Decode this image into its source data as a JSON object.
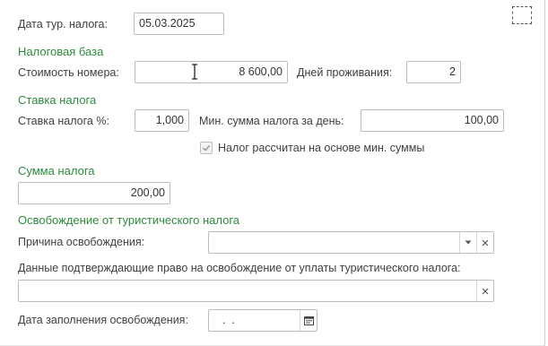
{
  "header": {
    "tour_date_label": "Дата тур. налога:",
    "tour_date_value": "05.03.2025"
  },
  "tax_base": {
    "section_title": "Налоговая база",
    "room_cost_label": "Стоимость номера:",
    "room_cost_value": "8 600,00",
    "days_label": "Дней проживания:",
    "days_value": "2"
  },
  "tax_rate": {
    "section_title": "Ставка налога",
    "rate_label": "Ставка налога %:",
    "rate_value": "1,000",
    "min_per_day_label": "Мин. сумма налога за день:",
    "min_per_day_value": "100,00",
    "min_checkbox_label": "Налог рассчитан на основе мин. суммы",
    "min_checkbox_checked": true
  },
  "tax_amount": {
    "section_title": "Сумма налога",
    "value": "200,00"
  },
  "exemption": {
    "section_title": "Освобождение от туристического налога",
    "reason_label": "Причина освобождения:",
    "reason_value": "",
    "proof_label": "Данные подтверждающие право на освобождение от уплаты туристического налога:",
    "proof_value": "",
    "fill_date_label": "Дата заполнения освобождения:",
    "fill_date_value": "  .  ."
  },
  "icons": {
    "dropdown": "chevron-down-icon",
    "clear": "clear-x-icon",
    "calendar": "calendar-icon",
    "cursor": "text-cursor-icon",
    "checkmark": "checkmark-icon"
  },
  "colors": {
    "section_title": "#2e8b3e",
    "border": "#bdbdbd"
  }
}
